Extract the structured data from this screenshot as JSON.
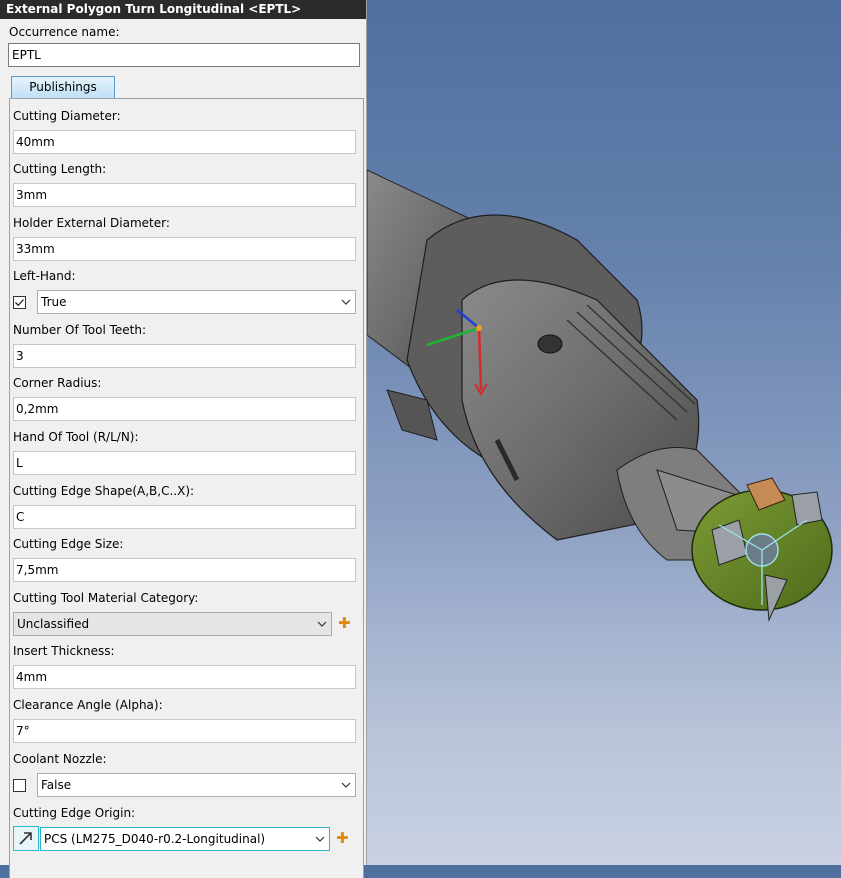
{
  "panel": {
    "title": "External Polygon Turn Longitudinal <EPTL>",
    "occurrence_label": "Occurrence name:",
    "occurrence_value": "EPTL",
    "tab_label": "Publishings"
  },
  "fields": {
    "cutting_diameter": {
      "label": "Cutting Diameter:",
      "value": "40mm"
    },
    "cutting_length": {
      "label": "Cutting Length:",
      "value": "3mm"
    },
    "holder_external_diameter": {
      "label": "Holder External Diameter:",
      "value": "33mm"
    },
    "left_hand": {
      "label": "Left-Hand:",
      "checked": true,
      "value": "True"
    },
    "number_of_tool_teeth": {
      "label": "Number Of Tool Teeth:",
      "value": "3"
    },
    "corner_radius": {
      "label": "Corner Radius:",
      "value": "0,2mm"
    },
    "hand_of_tool": {
      "label": "Hand Of Tool (R/L/N):",
      "value": "L"
    },
    "cutting_edge_shape": {
      "label": "Cutting Edge Shape(A,B,C..X):",
      "value": "C"
    },
    "cutting_edge_size": {
      "label": "Cutting Edge Size:",
      "value": "7,5mm"
    },
    "material_category": {
      "label": "Cutting Tool Material Category:",
      "value": "Unclassified"
    },
    "insert_thickness": {
      "label": "Insert Thickness:",
      "value": "4mm"
    },
    "clearance_angle": {
      "label": "Clearance Angle (Alpha):",
      "value": "7°"
    },
    "coolant_nozzle": {
      "label": "Coolant Nozzle:",
      "checked": false,
      "value": "False"
    },
    "cutting_edge_origin": {
      "label": "Cutting Edge Origin:",
      "value": "PCS (LM275_D040-r0.2-Longitudinal)"
    }
  },
  "icons": {
    "add": "plus-icon",
    "dropdown": "chevron-down-icon",
    "origin": "arrow-up-right-icon",
    "check": "checkmark-icon"
  },
  "colors": {
    "title_bar": "#2b2b2b",
    "tab_accent": "#5a9bd2",
    "add_icon": "#e08a0c",
    "origin_highlight": "#2fb8cc",
    "tool_body": "#6f6f6f",
    "cutter_head": "#5c7a22",
    "viewport_bg_top": "#4f6f9f",
    "viewport_bg_bottom": "#c9d1e2"
  }
}
